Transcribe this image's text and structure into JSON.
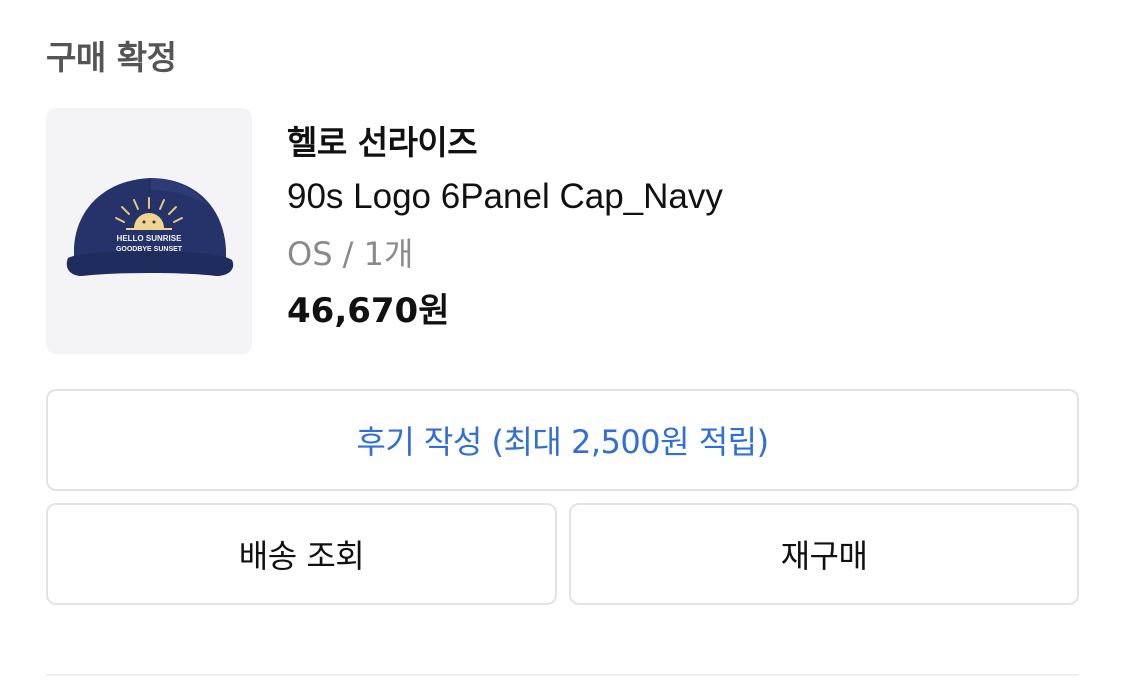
{
  "order": {
    "status_title": "구매 확정"
  },
  "product": {
    "brand": "헬로 선라이즈",
    "name": "90s Logo 6Panel Cap_Navy",
    "option": "OS / 1개",
    "price": "46,670원",
    "image_text_line1": "HELLO SUNRISE",
    "image_text_line2": "GOODBYE SUNSET"
  },
  "actions": {
    "review_label": "후기 작성 (최대 2,500원 적립)",
    "track_label": "배송 조회",
    "rebuy_label": "재구매"
  },
  "colors": {
    "accent_link": "#2f6fd6",
    "cap_navy": "#233166"
  }
}
